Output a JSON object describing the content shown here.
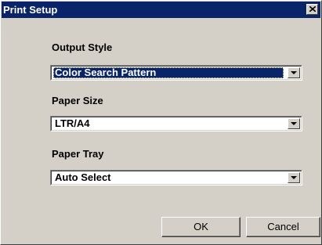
{
  "window": {
    "title": "Print Setup",
    "close_icon": "close-icon"
  },
  "fields": [
    {
      "label": "Output Style",
      "value": "Color Search Pattern",
      "focused": true
    },
    {
      "label": "Paper Size",
      "value": "LTR/A4",
      "focused": false
    },
    {
      "label": "Paper Tray",
      "value": "Auto Select",
      "focused": false
    }
  ],
  "buttons": {
    "ok_label": "OK",
    "cancel_label": "Cancel"
  },
  "colors": {
    "titlebar": "#0a246a",
    "face": "#d4d0c8",
    "selection": "#0a246a"
  }
}
